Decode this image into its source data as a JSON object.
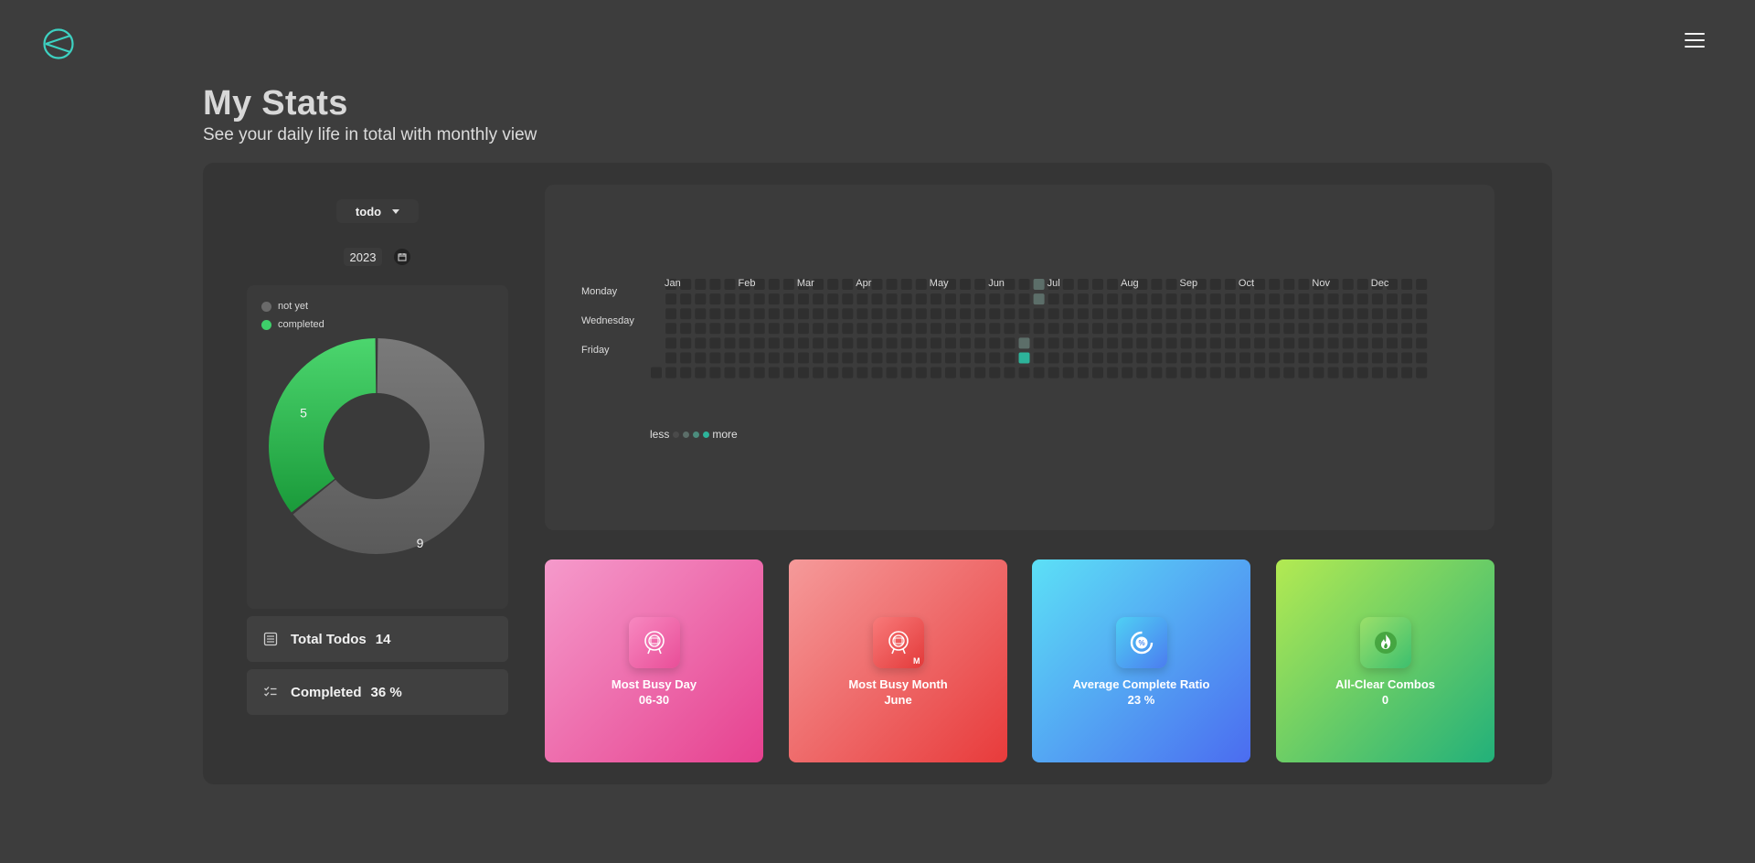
{
  "header": {
    "logo_icon": "brand-logo-icon",
    "menu_icon": "hamburger-menu-icon"
  },
  "page": {
    "title": "My Stats",
    "subtitle": "See your daily life in total with monthly view"
  },
  "filters": {
    "category": "todo",
    "year": "2023"
  },
  "donut": {
    "legend": [
      {
        "label": "not yet",
        "color": "#6a6a6a"
      },
      {
        "label": "completed",
        "color": "#3ecf6a"
      }
    ],
    "chart_data": {
      "type": "pie",
      "categories": [
        "not yet",
        "completed"
      ],
      "values": [
        9,
        5
      ],
      "labels": [
        "9",
        "5"
      ]
    }
  },
  "stats": [
    {
      "label": "Total Todos",
      "value": "14",
      "icon": "list-icon"
    },
    {
      "label": "Completed",
      "value": "36 %",
      "icon": "checklist-icon"
    }
  ],
  "heatmap": {
    "months": [
      "Jan",
      "Feb",
      "Mar",
      "Apr",
      "May",
      "Jun",
      "Jul",
      "Aug",
      "Sep",
      "Oct",
      "Nov",
      "Dec"
    ],
    "days": [
      "Monday",
      "Wednesday",
      "Friday"
    ],
    "legend_less": "less",
    "legend_more": "more",
    "levels": [
      "#3f3f3f",
      "#5c6e69",
      "#4c8c7d",
      "#2db39a"
    ],
    "active": [
      {
        "date": "06-26",
        "level": 1
      },
      {
        "date": "06-27",
        "level": 1
      },
      {
        "date": "06-23",
        "level": 1
      },
      {
        "date": "06-24",
        "level": 3
      }
    ]
  },
  "cards": [
    {
      "label": "Most Busy Day",
      "value": "06-30",
      "icon": "calendar-day-icon",
      "from": "#f59acb",
      "to": "#e6418f",
      "badge_from": "#f788c0",
      "badge_to": "#e94e98"
    },
    {
      "label": "Most Busy Month",
      "value": "June",
      "icon": "calendar-month-icon",
      "badge": "M",
      "from": "#f59a9a",
      "to": "#e83b3b",
      "badge_from": "#f87a7a",
      "badge_to": "#e33a3a"
    },
    {
      "label": "Average Complete Ratio",
      "value": "23 %",
      "icon": "percent-ring-icon",
      "from": "#5ce0f6",
      "to": "#4b6cf0",
      "badge_from": "#4fd0f4",
      "badge_to": "#4b7cf0"
    },
    {
      "label": "All-Clear Combos",
      "value": "0",
      "icon": "flame-icon",
      "from": "#b3ea52",
      "to": "#22b07a",
      "badge_from": "#9be06a",
      "badge_to": "#3cbf6e"
    }
  ]
}
